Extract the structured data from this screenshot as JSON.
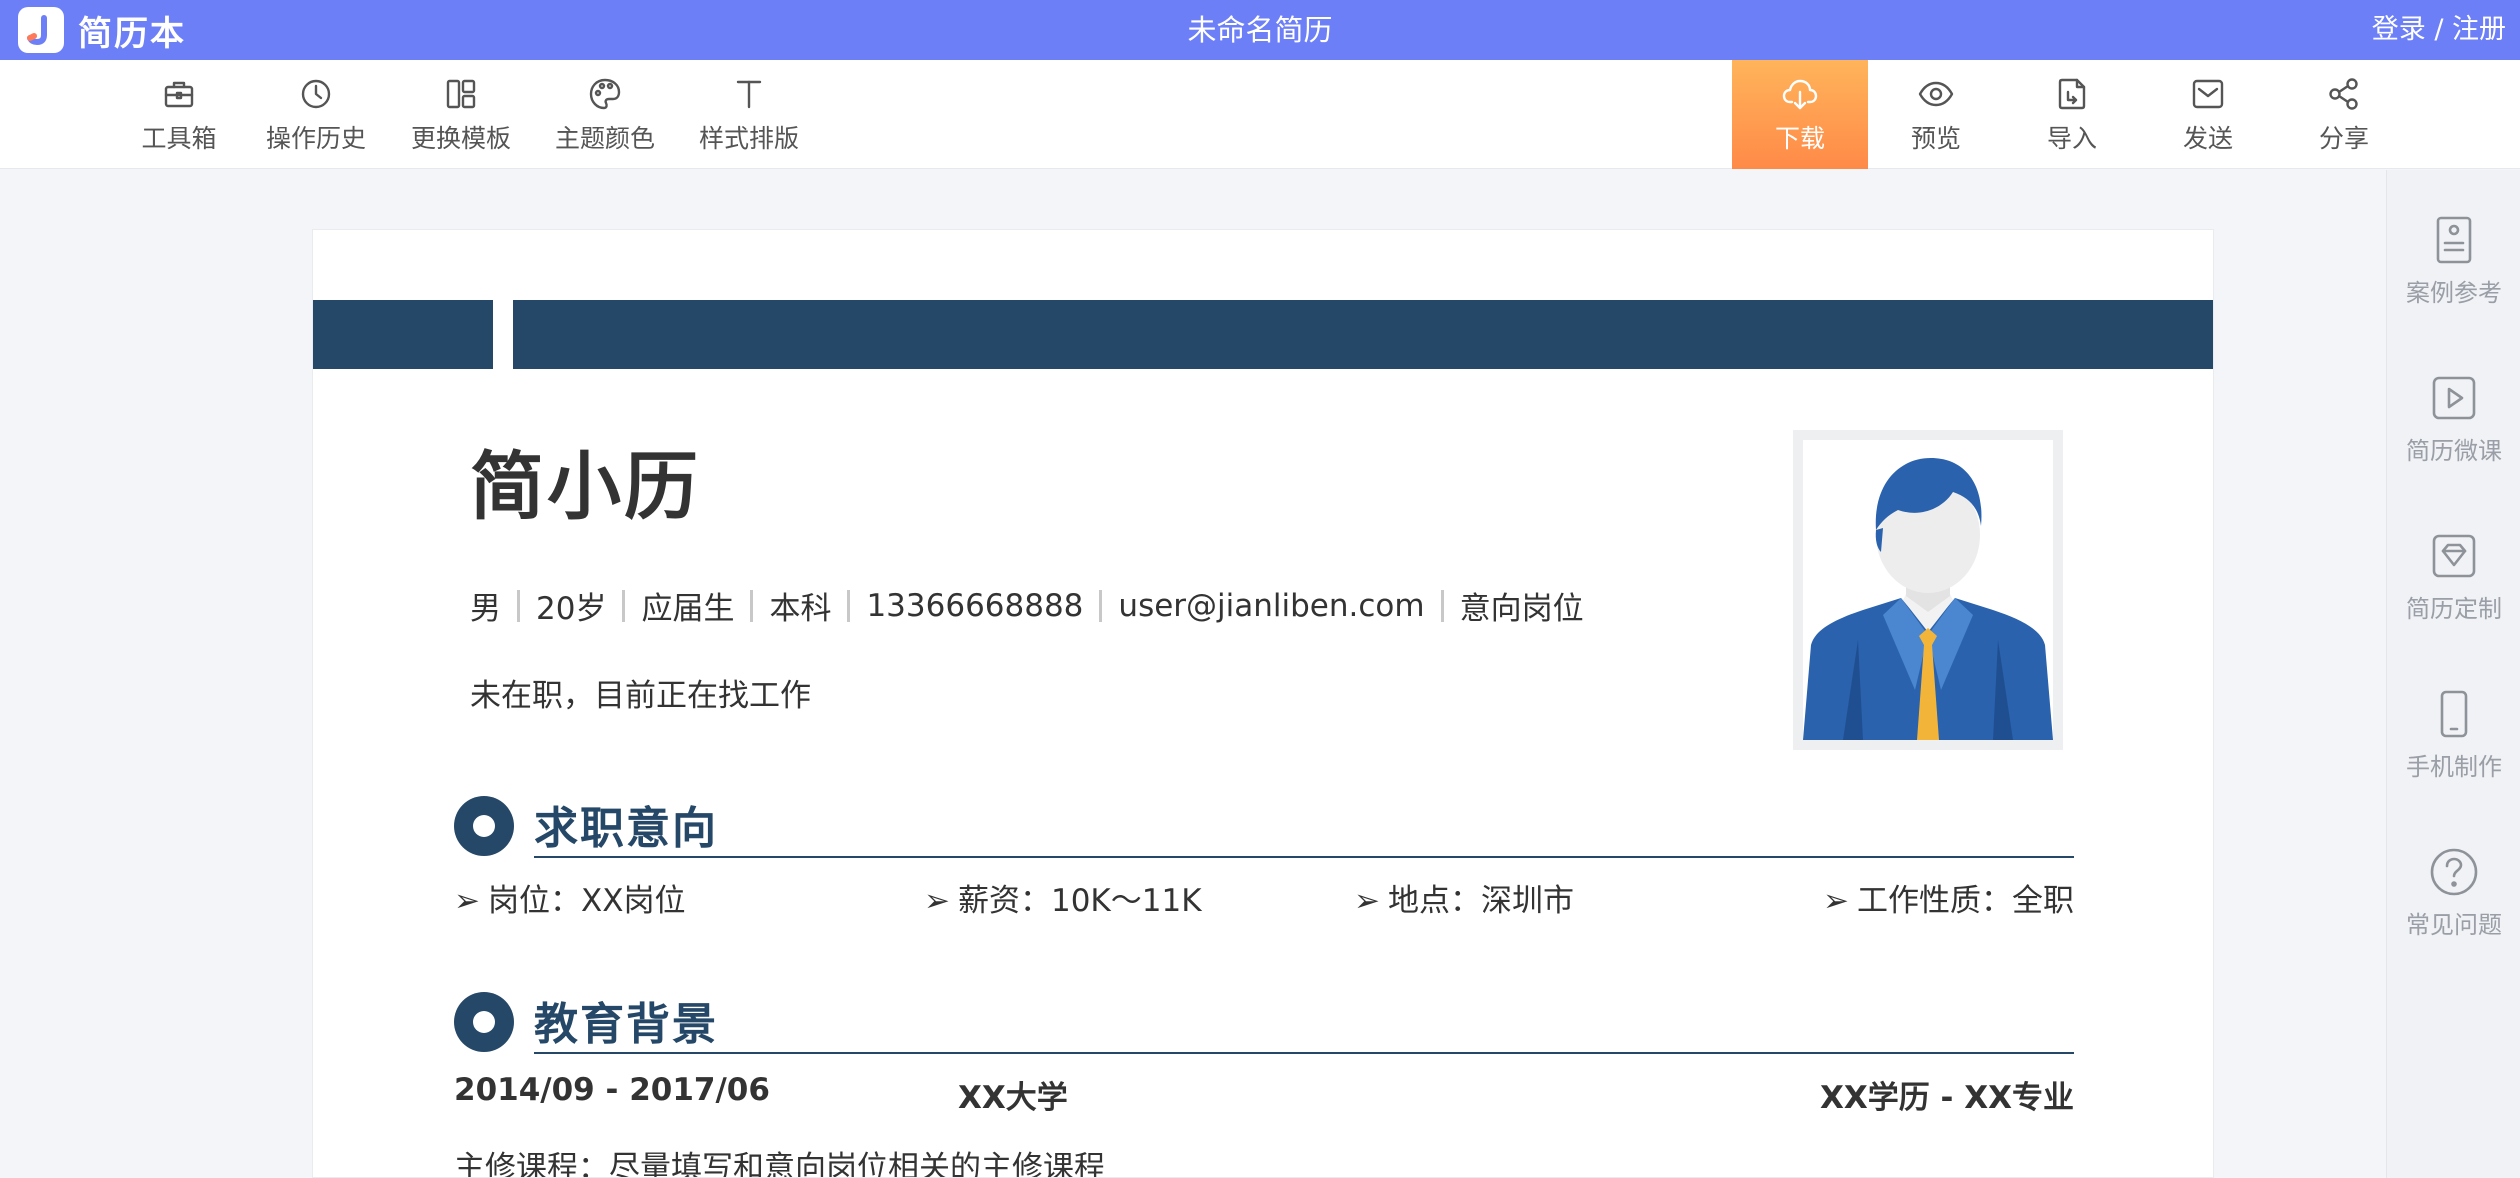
{
  "topbar": {
    "logo_letter": "J",
    "logo_text": "简历本",
    "doc_title": "未命名简历",
    "login": "登录",
    "auth_sep": " / ",
    "register": "注册"
  },
  "toolbar": {
    "left": [
      {
        "label": "工具箱",
        "icon": "toolbox-icon"
      },
      {
        "label": "操作历史",
        "icon": "clock-icon"
      },
      {
        "label": "更换模板",
        "icon": "layout-icon"
      },
      {
        "label": "主题颜色",
        "icon": "palette-icon"
      },
      {
        "label": "样式排版",
        "icon": "text-icon"
      }
    ],
    "right": [
      {
        "label": "下载",
        "icon": "cloud-download-icon"
      },
      {
        "label": "预览",
        "icon": "eye-icon"
      },
      {
        "label": "导入",
        "icon": "import-icon"
      },
      {
        "label": "发送",
        "icon": "mail-icon"
      },
      {
        "label": "分享",
        "icon": "share-icon"
      }
    ]
  },
  "sidebar": {
    "items": [
      {
        "label": "案例参考",
        "icon": "document-icon"
      },
      {
        "label": "简历微课",
        "icon": "play-icon"
      },
      {
        "label": "简历定制",
        "icon": "gem-icon"
      },
      {
        "label": "手机制作",
        "icon": "phone-icon"
      },
      {
        "label": "常见问题",
        "icon": "question-icon"
      }
    ]
  },
  "resume": {
    "name": "简小历",
    "info": [
      "男",
      "20岁",
      "应届生",
      "本科",
      "13366668888",
      "user@jianliben.com",
      "意向岗位"
    ],
    "status": "未在职，目前正在找工作",
    "theme_color": "#264868",
    "sections": {
      "intent": {
        "title": "求职意向",
        "arrow": "➢",
        "items": [
          "岗位：XX岗位",
          "薪资：10K～11K",
          "地点：深圳市",
          "工作性质：全职"
        ]
      },
      "education": {
        "title": "教育背景",
        "period": "2014/09 - 2017/06",
        "school": "XX大学",
        "degree": "XX学历 - XX专业",
        "courses": "主修课程：尽量填写和意向岗位相关的主修课程"
      }
    }
  },
  "colors": {
    "topbar": "#6c7ff7",
    "download_start": "#ffb45a",
    "download_end": "#ff8a48"
  }
}
